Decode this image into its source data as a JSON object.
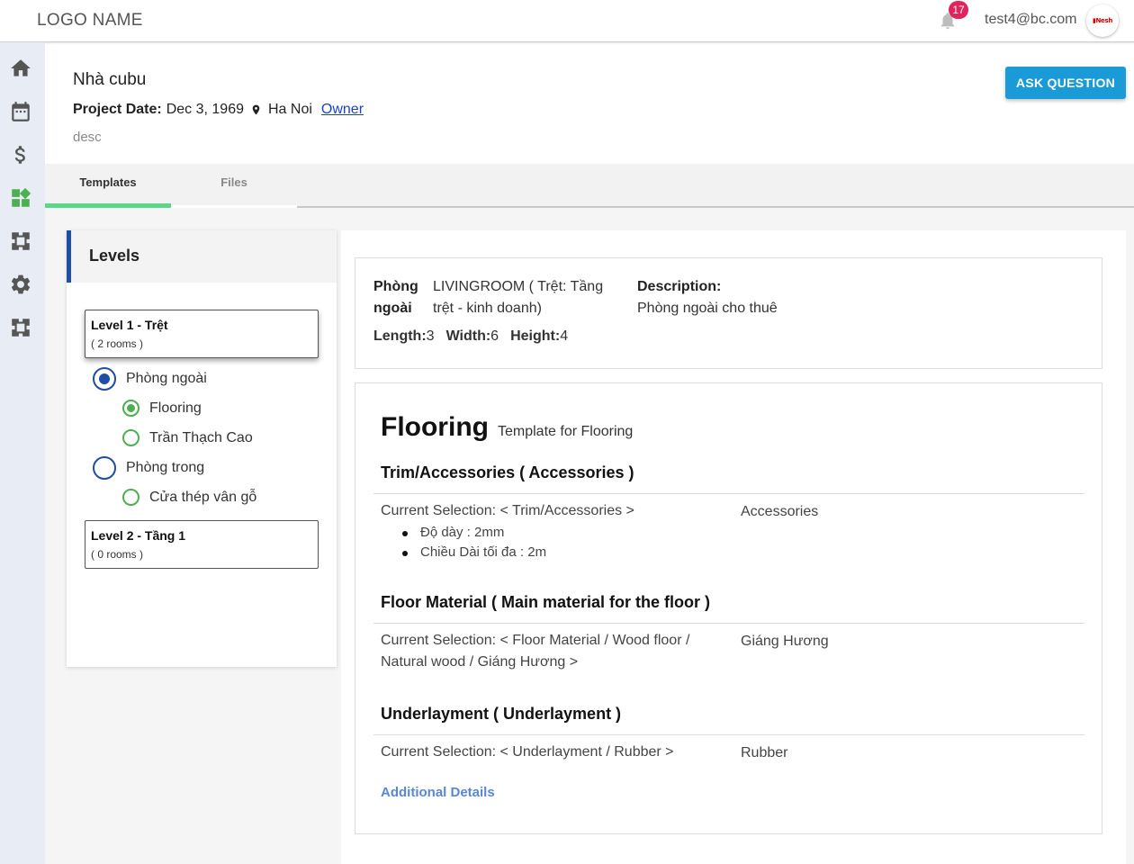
{
  "header": {
    "logo": "LOGO NAME",
    "notifications_count": "17",
    "user_email": "test4@bc.com"
  },
  "sidebar": {
    "items": [
      {
        "icon": "home-icon"
      },
      {
        "icon": "calendar-icon"
      },
      {
        "icon": "dollar-icon"
      },
      {
        "icon": "widgets-icon",
        "active": true
      },
      {
        "icon": "puzzle-icon"
      },
      {
        "icon": "gear-icon"
      },
      {
        "icon": "puzzle-icon"
      }
    ],
    "active_color": "#4caf50",
    "icon_color": "#555555"
  },
  "project": {
    "title": "Nhà cubu",
    "date_label": "Project Date:",
    "date_value": "Dec 3, 1969",
    "location": "Ha Noi",
    "owner_link": "Owner",
    "description": "desc",
    "ask_button": "ASK QUESTION"
  },
  "tabs": [
    {
      "label": "Templates",
      "active": true
    },
    {
      "label": "Files",
      "active": false
    }
  ],
  "levels": {
    "title": "Levels",
    "items": [
      {
        "name": "Level 1 - Trệt",
        "count": "( 2 rooms )",
        "rooms": [
          {
            "name": "Phòng ngoài",
            "checked": true,
            "templates": [
              {
                "name": "Flooring",
                "checked": true
              },
              {
                "name": "Trần Thạch Cao",
                "checked": false
              }
            ]
          },
          {
            "name": "Phòng trong",
            "checked": false,
            "templates": [
              {
                "name": "Cửa thép vân gỗ",
                "checked": false
              }
            ]
          }
        ]
      },
      {
        "name": "Level 2 - Tầng 1",
        "count": "( 0 rooms )",
        "rooms": []
      }
    ]
  },
  "room": {
    "label": "Phòng ngoài",
    "name": "LIVINGROOM ( Trệt: Tầng trệt - kinh doanh)",
    "description_label": "Description:",
    "description": "Phòng ngoài cho thuê",
    "length_label": "Length:",
    "length": "3",
    "width_label": "Width:",
    "width": "6",
    "height_label": "Height:",
    "height": "4"
  },
  "template": {
    "title": "Flooring",
    "subtitle": "Template for Flooring",
    "sections": [
      {
        "title": "Trim/Accessories ( Accessories )",
        "selection": "Current Selection: < Trim/Accessories >",
        "value": "Accessories",
        "details": [
          "Độ dày : 2mm",
          "Chiều Dài tối đa : 2m"
        ]
      },
      {
        "title": "Floor Material ( Main material for the floor )",
        "selection": "Current Selection: < Floor Material / Wood floor / Natural wood / Giáng Hương >",
        "value": "Giáng Hương",
        "details": []
      },
      {
        "title": "Underlayment ( Underlayment )",
        "selection": "Current Selection: < Underlayment / Rubber >",
        "value": "Rubber",
        "details": []
      }
    ],
    "additional_link": "Additional Details"
  },
  "colors": {
    "accent_blue": "#1a9bd7",
    "level_border": "#1f4ea3",
    "radio_green": "#4caf50",
    "tab_underline": "#5cd68a",
    "badge": "#e0245e",
    "link": "#5a86d6"
  }
}
